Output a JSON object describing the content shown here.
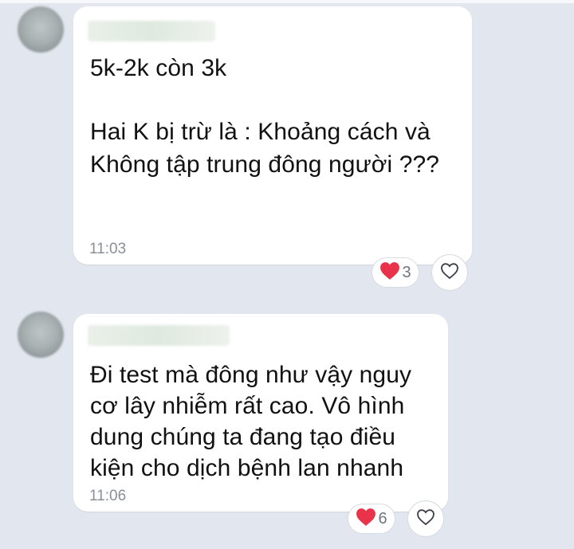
{
  "messages": [
    {
      "text_lines": [
        "5k-2k còn 3k",
        "",
        "Hai K bị trừ là : Khoảng cách và",
        "Không tập trung đông người ???"
      ],
      "time": "11:03",
      "reaction": {
        "icon": "heart-icon",
        "count": "3"
      }
    },
    {
      "text_lines": [
        "Đi test mà đông như vậy nguy",
        "cơ lây nhiễm rất cao. Vô hình",
        "dung chúng ta đang tạo điều",
        "kiện cho dịch bệnh lan nhanh"
      ],
      "time": "11:06",
      "reaction": {
        "icon": "heart-icon",
        "count": "6"
      }
    }
  ],
  "colors": {
    "background": "#e2e6ee",
    "bubble": "#ffffff",
    "heart": "#e8334a",
    "timestamp": "#8a8f98"
  },
  "icons": [
    "heart-icon",
    "like-heart-outline-icon"
  ]
}
